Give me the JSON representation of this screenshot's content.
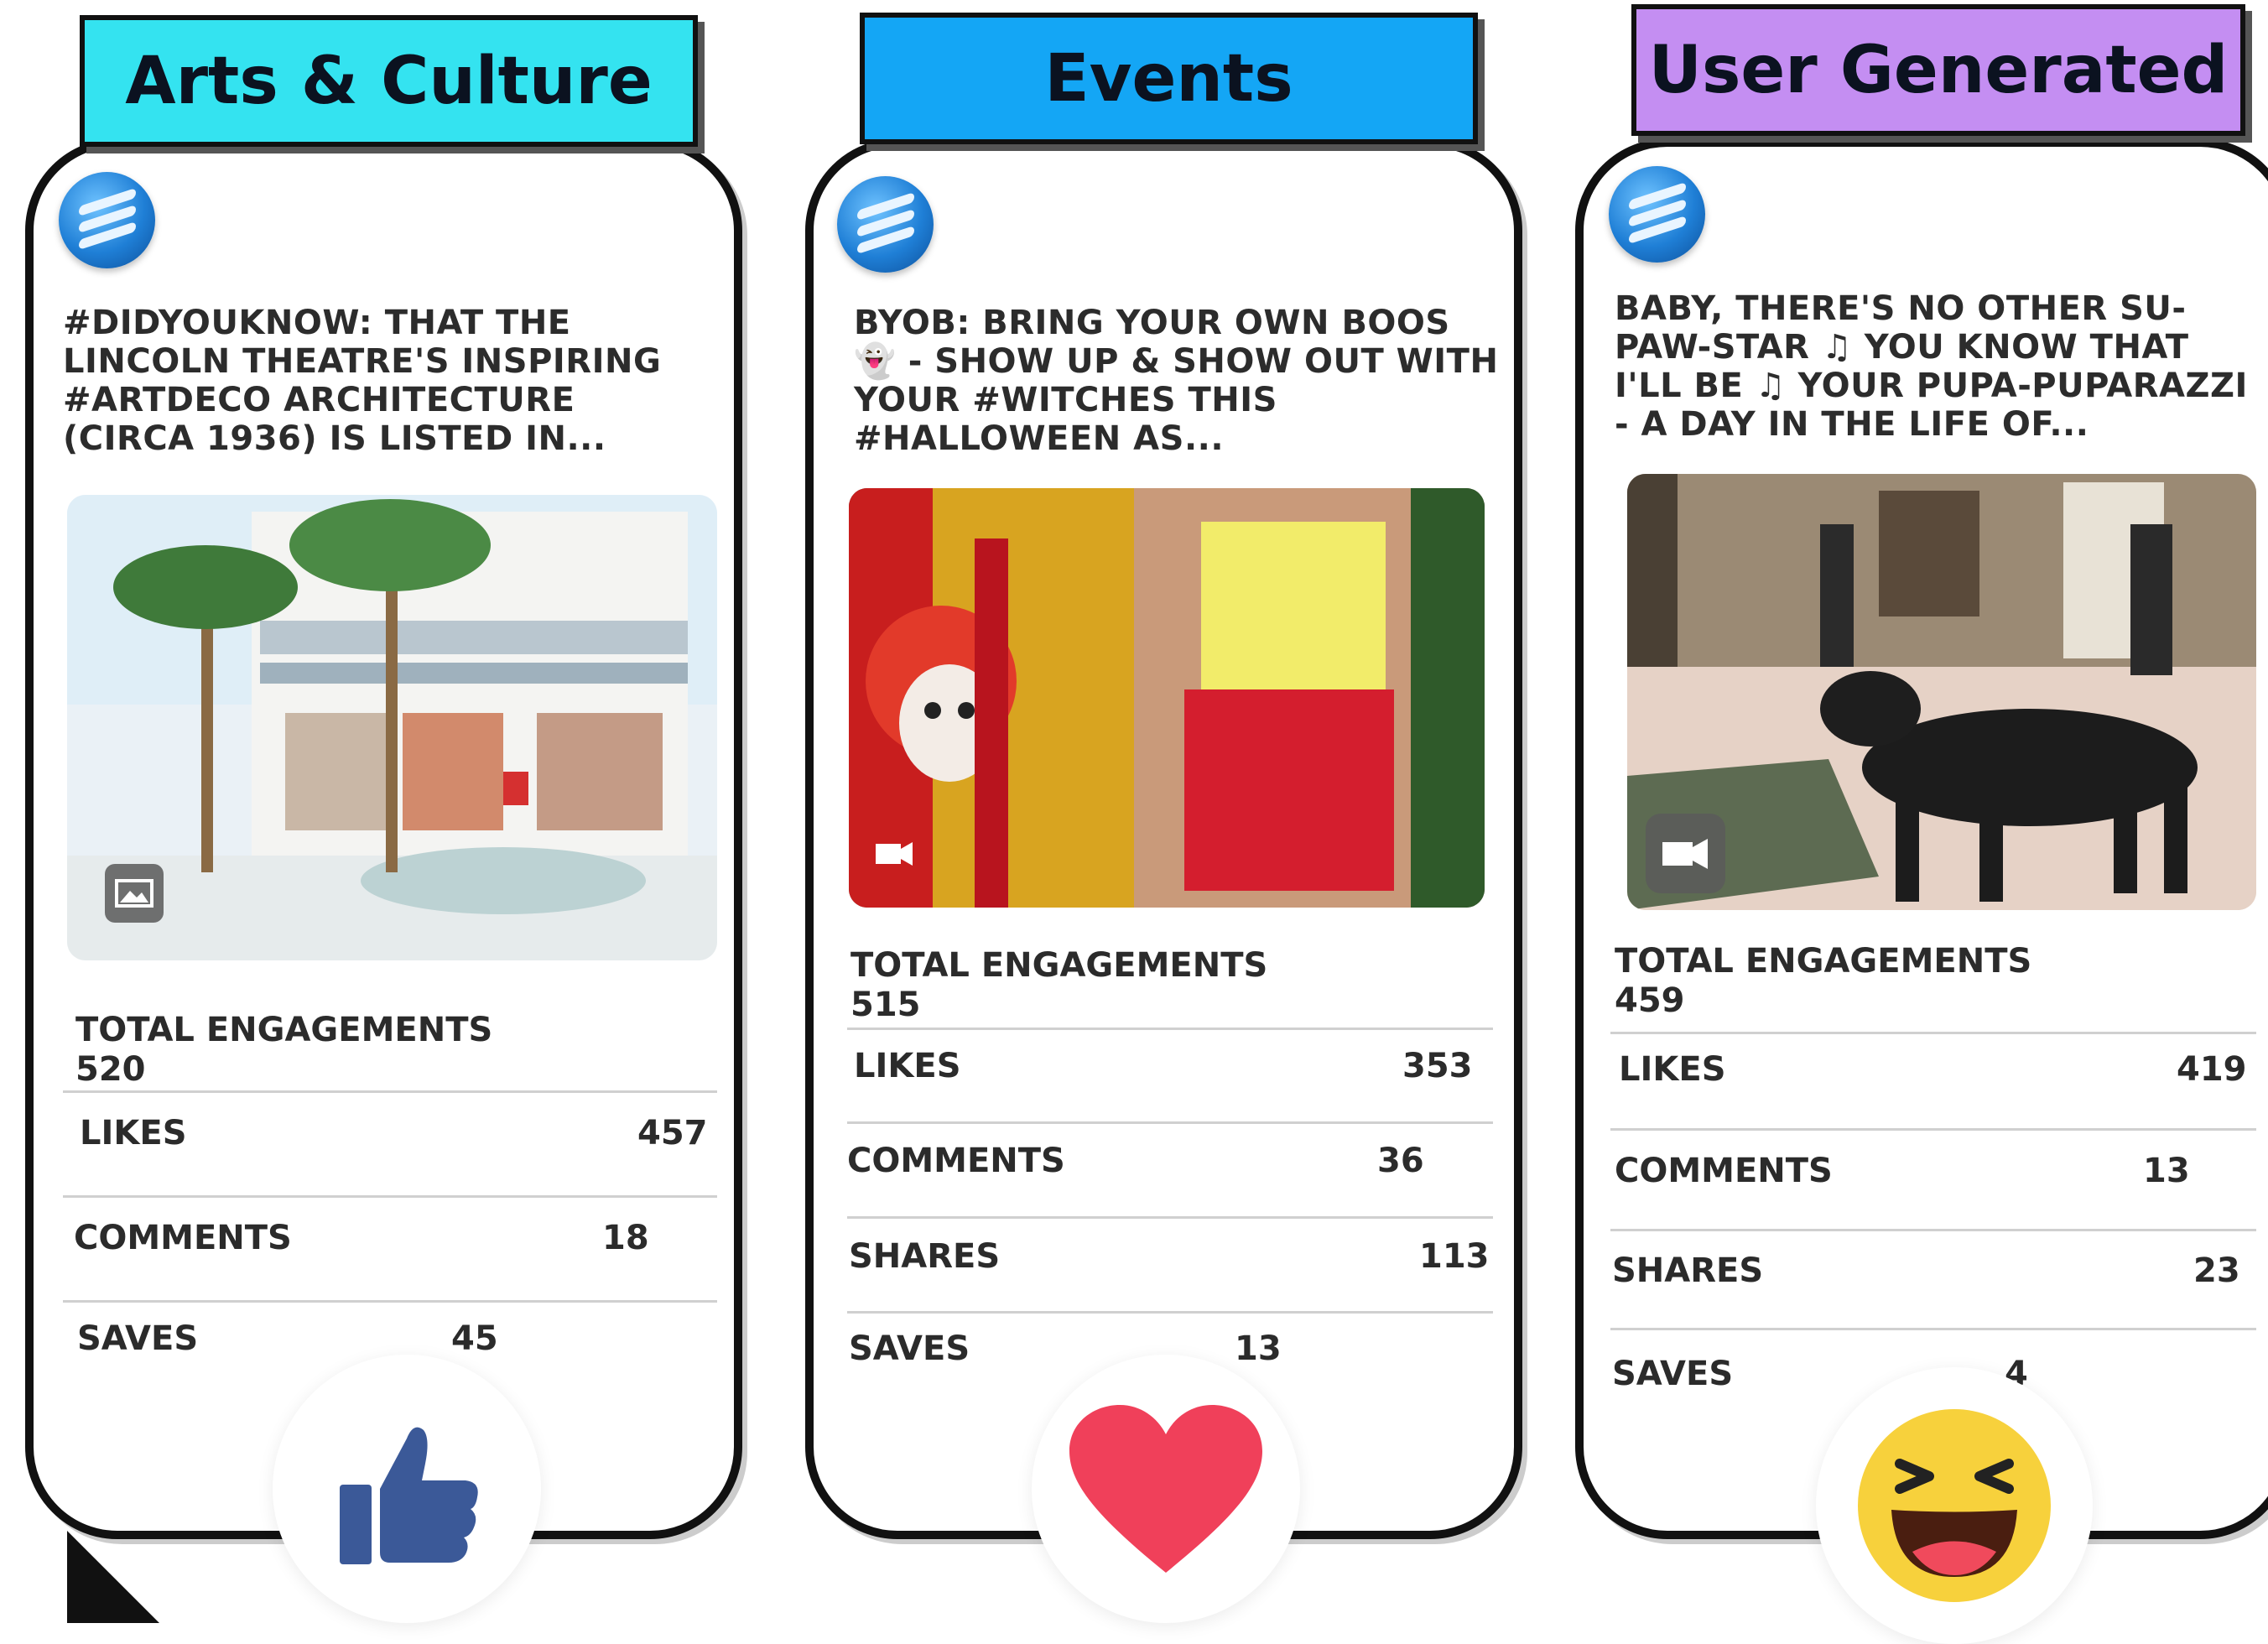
{
  "tabs": {
    "arts": "Arts & Culture",
    "events": "Events",
    "ugc": "User Generated"
  },
  "colors": {
    "arts_tab": "#34e3f0",
    "events_tab": "#14a6f5",
    "ugc_tab": "#c48ef2",
    "like_blue": "#3b5998",
    "heart_red": "#f0405a",
    "haha_yellow": "#f7d13c"
  },
  "cards": [
    {
      "caption": "#DIDYOUKNOW: THAT THE LINCOLN THEATRE'S INSPIRING #ARTDECO ARCHITECTURE (CIRCA 1936) IS LISTED IN...",
      "media_icon": "image-icon",
      "total_label": "TOTAL ENGAGEMENTS",
      "total_value": "520",
      "stats": [
        {
          "label": "LIKES",
          "value": "457"
        },
        {
          "label": "COMMENTS",
          "value": "18"
        },
        {
          "label": "SAVES",
          "value": "45"
        }
      ],
      "reaction": "thumbs-up-icon"
    },
    {
      "caption": "BYOB: BRING YOUR OWN BOOS 👻 - SHOW UP & SHOW OUT WITH YOUR #WITCHES THIS #HALLOWEEN AS...",
      "media_icon": "video-icon",
      "total_label": "TOTAL ENGAGEMENTS",
      "total_value": "515",
      "stats": [
        {
          "label": "LIKES",
          "value": "353"
        },
        {
          "label": "COMMENTS",
          "value": "36"
        },
        {
          "label": "SHARES",
          "value": "113"
        },
        {
          "label": "SAVES",
          "value": "13"
        }
      ],
      "reaction": "heart-icon"
    },
    {
      "caption": "BABY, THERE'S NO OTHER SU-PAW-STAR ♫ YOU KNOW THAT I'LL BE ♫ YOUR PUPA-PUPARAZZI - A DAY IN THE LIFE OF...",
      "media_icon": "video-icon",
      "total_label": "TOTAL ENGAGEMENTS",
      "total_value": "459",
      "stats": [
        {
          "label": "LIKES",
          "value": "419"
        },
        {
          "label": "COMMENTS",
          "value": "13"
        },
        {
          "label": "SHARES",
          "value": "23"
        },
        {
          "label": "SAVES",
          "value": "4"
        }
      ],
      "reaction": "laughing-face-icon"
    }
  ]
}
